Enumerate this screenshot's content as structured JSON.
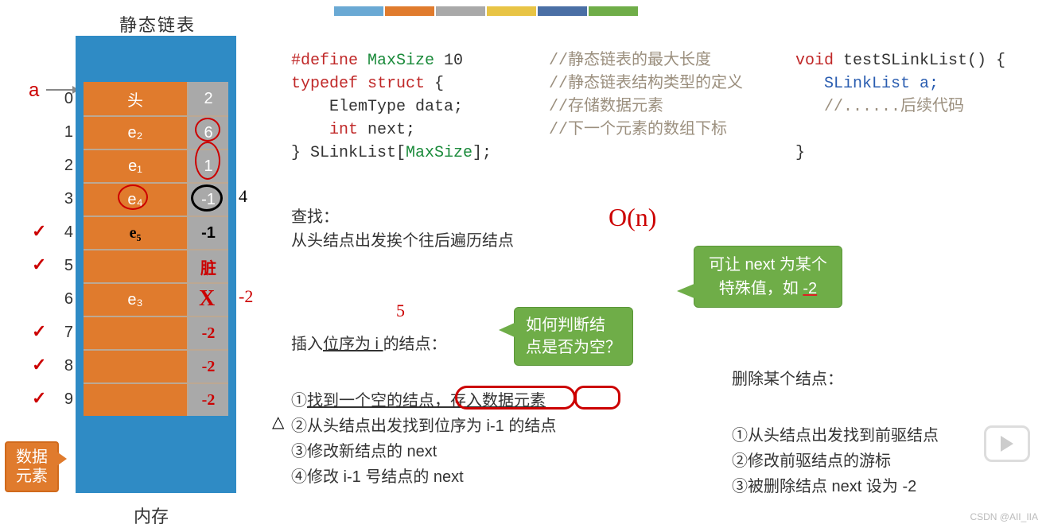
{
  "title_top": "静态链表",
  "a_label": "a",
  "mem_label": "内存",
  "data_label": "数据\n元素",
  "rows": [
    {
      "idx": "0",
      "data": "头",
      "next": "2"
    },
    {
      "idx": "1",
      "data": "e₂",
      "next": "6"
    },
    {
      "idx": "2",
      "data": "e₁",
      "next": "1"
    },
    {
      "idx": "3",
      "data": "e₄",
      "next": "-1"
    },
    {
      "idx": "4",
      "data": "e₅",
      "next": "-1"
    },
    {
      "idx": "5",
      "data": "",
      "next": "脏"
    },
    {
      "idx": "6",
      "data": "e₃",
      "next": "X"
    },
    {
      "idx": "7",
      "data": "",
      "next": "-2"
    },
    {
      "idx": "8",
      "data": "",
      "next": "-2"
    },
    {
      "idx": "9",
      "data": "",
      "next": "-2"
    }
  ],
  "checks": [
    "4",
    "5",
    "7",
    "8",
    "9"
  ],
  "ann_four": "4",
  "ann_minus2": "-2",
  "ann_5": "5",
  "swatches": [
    "#6aa9d4",
    "#e07b2d",
    "#a9a9a9",
    "#e8c445",
    "#4a6fa5",
    "#6fad48"
  ],
  "code1": {
    "l1a": "#define ",
    "l1b": "MaxSize ",
    "l1c": "10",
    "l2a": "typedef ",
    "l2b": "struct ",
    "l2c": "{",
    "l3": "    ElemType data;",
    "l4a": "    ",
    "l4b": "int ",
    "l4c": "next;",
    "l5a": "} SLinkList[",
    "l5b": "MaxSize",
    "l5c": "];"
  },
  "comments": {
    "c1": "//静态链表的最大长度",
    "c2": "//静态链表结构类型的定义",
    "c3": "//存储数据元素",
    "c4": "//下一个元素的数组下标"
  },
  "code2": {
    "l1a": "void ",
    "l1b": "testSLinkList() {",
    "l2": "   SLinkList a;",
    "l3": "   //......后续代码",
    "l4": "}"
  },
  "search_title": "查找：",
  "search_body": "从头结点出发挨个往后遍历结点",
  "big_on": "O(n)",
  "insert_line_a": "插入",
  "insert_line_b": "位序为 i ",
  "insert_line_c": "的结点：",
  "insert_steps": {
    "s1a": "①",
    "s1b": "找到一个空的结点，",
    "s1c": "存入数据元素",
    "s2": "②从头结点出发找到位序为 i-1 的结点",
    "s3": "③修改新结点的 next",
    "s4": "④修改 i-1 号结点的 next"
  },
  "bubble1_l1": "如何判断结",
  "bubble1_l2": "点是否为空？",
  "bubble2_l1": "可让 next 为某个",
  "bubble2_l2a": "特殊值，如 ",
  "bubble2_l2b": "-2",
  "delete_title": "删除某个结点：",
  "delete_steps": {
    "d1": "①从头结点出发找到前驱结点",
    "d2": "②修改前驱结点的游标",
    "d3": "③被删除结点 next 设为 -2"
  },
  "triangle": "△",
  "watermark": "CSDN @AII_IIA"
}
